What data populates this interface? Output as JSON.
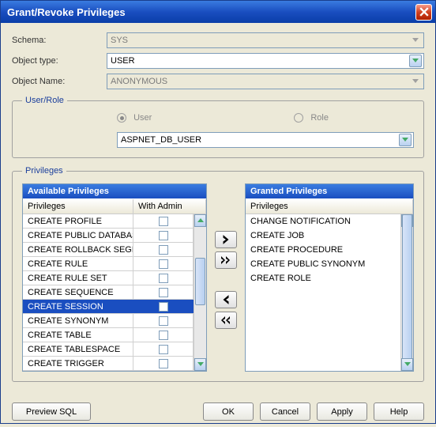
{
  "title": "Grant/Revoke Privileges",
  "form": {
    "schema_label": "Schema:",
    "schema_value": "SYS",
    "object_type_label": "Object type:",
    "object_type_value": "USER",
    "object_name_label": "Object Name:",
    "object_name_value": "ANONYMOUS"
  },
  "userrole": {
    "legend": "User/Role",
    "user_label": "User",
    "role_label": "Role",
    "selected": "User",
    "value": "ASPNET_DB_USER"
  },
  "privileges": {
    "legend": "Privileges",
    "available_header": "Available Privileges",
    "granted_header": "Granted Privileges",
    "col_privileges": "Privileges",
    "col_withadmin": "With Admin",
    "available": [
      {
        "name": "CREATE PROFILE",
        "admin": false,
        "selected": false
      },
      {
        "name": "CREATE PUBLIC DATABASE",
        "admin": false,
        "selected": false
      },
      {
        "name": "CREATE ROLLBACK SEGMEN",
        "admin": false,
        "selected": false
      },
      {
        "name": "CREATE RULE",
        "admin": false,
        "selected": false
      },
      {
        "name": "CREATE RULE SET",
        "admin": false,
        "selected": false
      },
      {
        "name": "CREATE SEQUENCE",
        "admin": false,
        "selected": false
      },
      {
        "name": "CREATE SESSION",
        "admin": false,
        "selected": true
      },
      {
        "name": "CREATE SYNONYM",
        "admin": false,
        "selected": false
      },
      {
        "name": "CREATE TABLE",
        "admin": false,
        "selected": false
      },
      {
        "name": "CREATE TABLESPACE",
        "admin": false,
        "selected": false
      },
      {
        "name": "CREATE TRIGGER",
        "admin": false,
        "selected": false
      }
    ],
    "granted": [
      "CHANGE NOTIFICATION",
      "CREATE JOB",
      "CREATE PROCEDURE",
      "CREATE PUBLIC SYNONYM",
      "CREATE ROLE"
    ]
  },
  "buttons": {
    "preview": "Preview SQL",
    "ok": "OK",
    "cancel": "Cancel",
    "apply": "Apply",
    "help": "Help"
  }
}
